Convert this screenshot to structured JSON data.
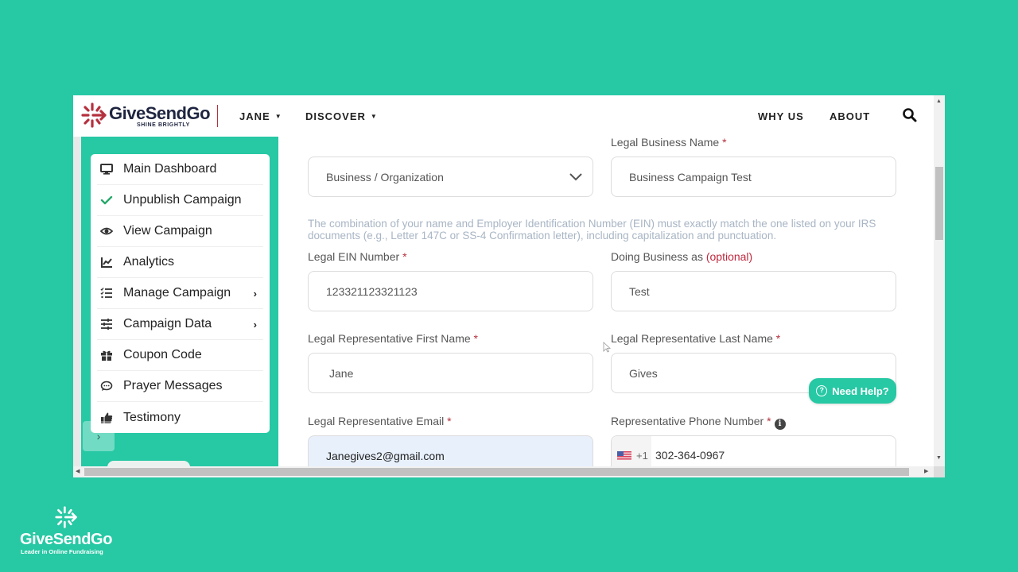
{
  "header": {
    "logo_name": "GiveSendGo",
    "logo_tagline": "SHINE BRIGHTLY",
    "nav_left": [
      {
        "label": "JANE",
        "has_dropdown": true
      },
      {
        "label": "DISCOVER",
        "has_dropdown": true
      }
    ],
    "nav_right": [
      {
        "label": "WHY US"
      },
      {
        "label": "ABOUT"
      }
    ],
    "search_icon": "search-icon"
  },
  "sidebar": {
    "items": [
      {
        "label": "Main Dashboard",
        "icon": "monitor-icon",
        "has_submenu": false
      },
      {
        "label": "Unpublish Campaign",
        "icon": "check-icon",
        "has_submenu": false
      },
      {
        "label": "View Campaign",
        "icon": "eye-icon",
        "has_submenu": false
      },
      {
        "label": "Analytics",
        "icon": "chart-line-icon",
        "has_submenu": false
      },
      {
        "label": "Manage Campaign",
        "icon": "list-check-icon",
        "has_submenu": true
      },
      {
        "label": "Campaign Data",
        "icon": "sliders-icon",
        "has_submenu": true
      },
      {
        "label": "Coupon Code",
        "icon": "gift-icon",
        "has_submenu": false
      },
      {
        "label": "Prayer Messages",
        "icon": "comment-icon",
        "has_submenu": false
      },
      {
        "label": "Testimony",
        "icon": "thumbs-up-icon",
        "has_submenu": false
      }
    ],
    "collapse_glyph": "›",
    "chevron_glyph": "›"
  },
  "form": {
    "account_type": {
      "value": "Business / Organization"
    },
    "legal_business_name": {
      "label": "Legal Business Name",
      "required": "*",
      "value": "Business Campaign Test"
    },
    "help_note": "The combination of your name and Employer Identification Number (EIN) must exactly match the one listed on your IRS documents (e.g., Letter 147C or SS-4 Confirmation letter), including capitalization and punctuation.",
    "ein": {
      "label": "Legal EIN Number",
      "required": "*",
      "value": "123321123321123"
    },
    "dba": {
      "label": "Doing Business as",
      "optional": "(optional)",
      "value": "Test"
    },
    "first_name": {
      "label": "Legal Representative First Name",
      "required": "*",
      "value": "Jane"
    },
    "last_name": {
      "label": "Legal Representative Last Name",
      "required": "*",
      "value": "Gives"
    },
    "email": {
      "label": "Legal Representative Email",
      "required": "*",
      "value": "Janegives2@gmail.com"
    },
    "phone": {
      "label": "Representative Phone Number",
      "required": "*",
      "info_glyph": "i",
      "country_code": "+1",
      "value": "302-364-0967"
    }
  },
  "need_help": {
    "label": "Need Help?",
    "glyph": "?"
  },
  "brand_footer": {
    "name": "GiveSendGo",
    "tagline": "Leader in Online Fundraising"
  },
  "colors": {
    "brand_teal": "#27c8a4",
    "brand_red": "#b5313f",
    "navy": "#1f2540",
    "autofill_blue": "#e8f0fc"
  }
}
